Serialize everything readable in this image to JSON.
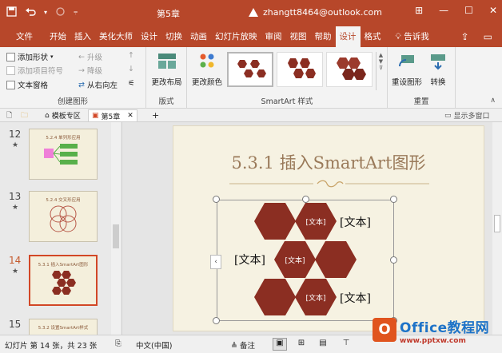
{
  "window": {
    "title": "第5章",
    "account": "zhangtt8464@outlook.com",
    "quick_access": [
      "save-icon",
      "undo-icon",
      "redo-icon",
      "customize-icon"
    ],
    "controls": [
      "ribbon-display-icon",
      "minimize-icon",
      "restore-icon",
      "close-icon"
    ]
  },
  "tabs": [
    {
      "label": "文件"
    },
    {
      "label": "开始"
    },
    {
      "label": "插入"
    },
    {
      "label": "美化大师"
    },
    {
      "label": "设计"
    },
    {
      "label": "切换"
    },
    {
      "label": "动画"
    },
    {
      "label": "幻灯片放映"
    },
    {
      "label": "审阅"
    },
    {
      "label": "视图"
    },
    {
      "label": "帮助"
    },
    {
      "label": "设计"
    },
    {
      "label": "格式"
    }
  ],
  "tellme": "告诉我",
  "ribbon": {
    "create_graphic": {
      "label": "创建图形",
      "add_shape": "添加形状",
      "add_bullet": "添加项目符号",
      "text_pane": "文本窗格",
      "promote": "升级",
      "demote": "降级",
      "right_to_left": "从右向左"
    },
    "layouts": {
      "label": "版式",
      "change_layout": "更改布局"
    },
    "smartart_styles": {
      "label": "SmartArt 样式",
      "change_colors": "更改颜色"
    },
    "reset": {
      "label": "重置",
      "reset_graphic": "重设图形",
      "convert": "转换"
    }
  },
  "doc_tabs": {
    "template": "模板专区",
    "current": "第5章",
    "multi_window": "显示多窗口"
  },
  "thumbnails": [
    {
      "num": "12",
      "title": "5.2.4 单列形应用",
      "star": "★"
    },
    {
      "num": "13",
      "title": "5.2.4 交叉形应用",
      "star": "★"
    },
    {
      "num": "14",
      "title": "5.3.1 插入SmartArt图形",
      "star": "★"
    },
    {
      "num": "15",
      "title": "5.3.2 设置SmartArt样式"
    }
  ],
  "slide": {
    "title": "5.3.1 插入SmartArt图形",
    "hex_inner": [
      "[文本]",
      "[文本]",
      "[文本]"
    ],
    "labels": [
      "[文本]",
      "[文本]",
      "[文本]"
    ],
    "collapse": "‹"
  },
  "status": {
    "slide_info": "幻灯片 第 14 张，共 23 张",
    "language": "中文(中国)",
    "notes": "备注"
  },
  "watermark": {
    "logo": "O",
    "title": "Office教程网",
    "url": "www.office26.com",
    "url2": "www.pptxw.com"
  },
  "colors": {
    "accent": "#b7472a",
    "hex_fill": "#8b2e22",
    "slide_bg": "#f6f2e2"
  }
}
